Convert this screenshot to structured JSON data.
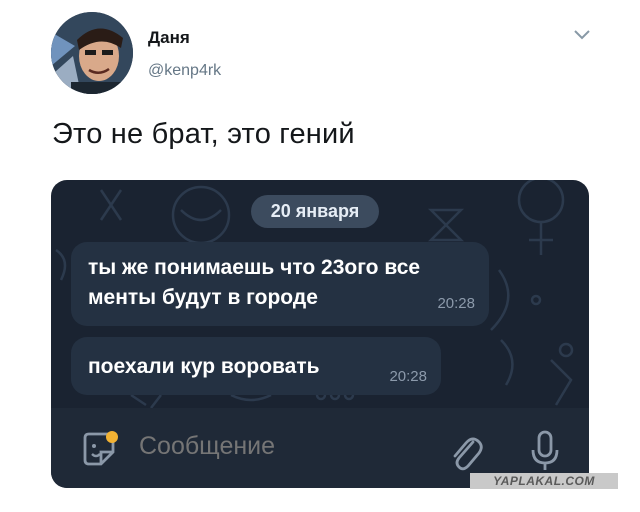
{
  "tweet": {
    "author_name": "Даня",
    "author_handle": "@kenp4rk",
    "text": "Это не брат, это гений"
  },
  "chat": {
    "date": "20 января",
    "messages": [
      {
        "text": "ты же понимаешь что 23ого все менты будут в городе",
        "time": "20:28"
      },
      {
        "text": "поехали кур воровать",
        "time": "20:28"
      }
    ],
    "composer_placeholder": "Сообщение"
  },
  "watermark": "YAPLAKAL.COM",
  "icons": [
    "avatar",
    "chevron-down-icon",
    "sticker-icon",
    "attach-icon",
    "mic-icon"
  ],
  "colors": {
    "chat_bg": "#1a2331",
    "bubble": "#243142",
    "date_pill": "#3c4b5e",
    "sticker_dot": "#f2b233"
  }
}
